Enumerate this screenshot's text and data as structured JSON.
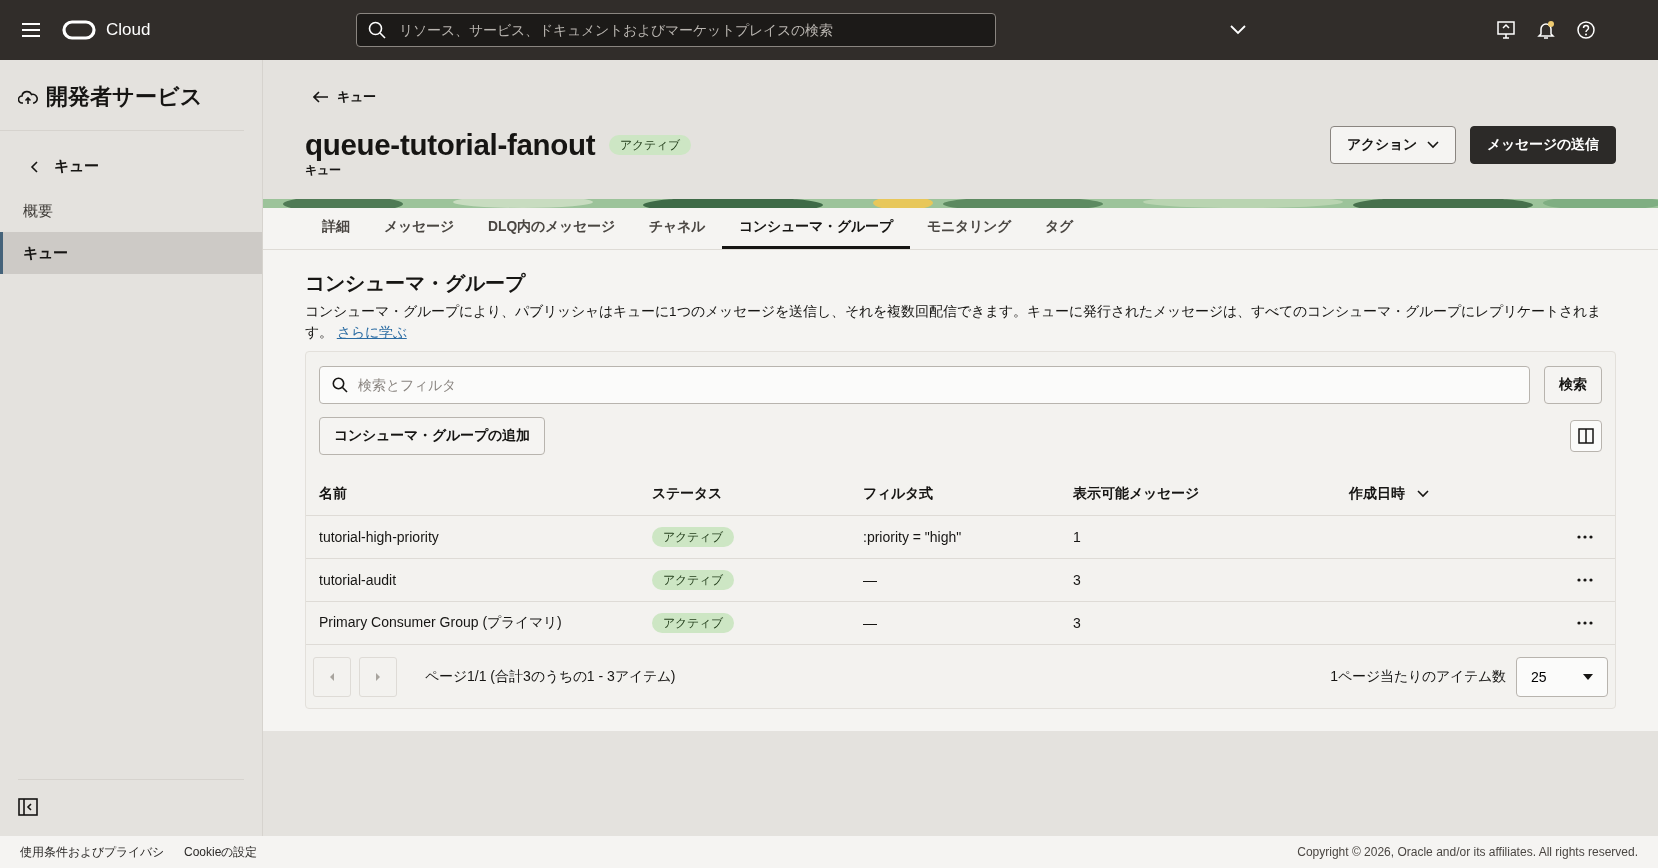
{
  "topbar": {
    "brand": "Cloud",
    "search": {
      "placeholder": "リソース、サービス、ドキュメントおよびマーケットプレイスの検索"
    }
  },
  "sidebar": {
    "title": "開発者サービス",
    "back": "キュー",
    "items": [
      {
        "label": "概要",
        "selected": false
      },
      {
        "label": "キュー",
        "selected": true
      }
    ]
  },
  "header": {
    "back": "キュー",
    "title": "queue-tutorial-fanout",
    "status": "アクティブ",
    "subtitle": "キュー",
    "buttons": [
      {
        "label": "アクション",
        "kind": "dropdown"
      },
      {
        "label": "メッセージの送信",
        "kind": "primary"
      }
    ]
  },
  "tabs": [
    {
      "label": "詳細",
      "selected": false
    },
    {
      "label": "メッセージ",
      "selected": false
    },
    {
      "label": "DLQ内のメッセージ",
      "selected": false
    },
    {
      "label": "チャネル",
      "selected": false
    },
    {
      "label": "コンシューマ・グループ",
      "selected": true
    },
    {
      "label": "モニタリング",
      "selected": false
    },
    {
      "label": "タグ",
      "selected": false
    }
  ],
  "section": {
    "title": "コンシューマ・グループ",
    "description": "コンシューマ・グループにより、パブリッシャはキューに1つのメッセージを送信し、それを複数回配信できます。キューに発行されたメッセージは、すべてのコンシューマ・グループにレプリケートされます。",
    "link": "さらに学ぶ"
  },
  "search": {
    "placeholder": "検索とフィルタ",
    "button": "検索"
  },
  "add_button": "コンシューマ・グループの追加",
  "table": {
    "columns": [
      {
        "label": "名前",
        "sorted": false
      },
      {
        "label": "ステータス",
        "sorted": false
      },
      {
        "label": "フィルタ式",
        "sorted": false
      },
      {
        "label": "表示可能メッセージ",
        "sorted": false
      },
      {
        "label": "作成日時",
        "sorted": true
      }
    ],
    "rows": [
      {
        "name": "tutorial-high-priority",
        "status": "アクティブ",
        "filter": ":priority = \"high\"",
        "visible": "1"
      },
      {
        "name": "tutorial-audit",
        "status": "アクティブ",
        "filter": "—",
        "visible": "3"
      },
      {
        "name": "Primary Consumer Group (プライマリ)",
        "status": "アクティブ",
        "filter": "—",
        "visible": "3"
      }
    ]
  },
  "pagination": {
    "summary": "ページ1/1 (合計3のうちの1 - 3アイテム)",
    "per_page_label": "1ページ当たりのアイテム数",
    "per_page": "25"
  },
  "footer": {
    "links": [
      "使用条件およびプライバシ",
      "Cookieの設定"
    ],
    "copyright": "Copyright © 2026, Oracle and/or its affiliates. All rights reserved."
  }
}
